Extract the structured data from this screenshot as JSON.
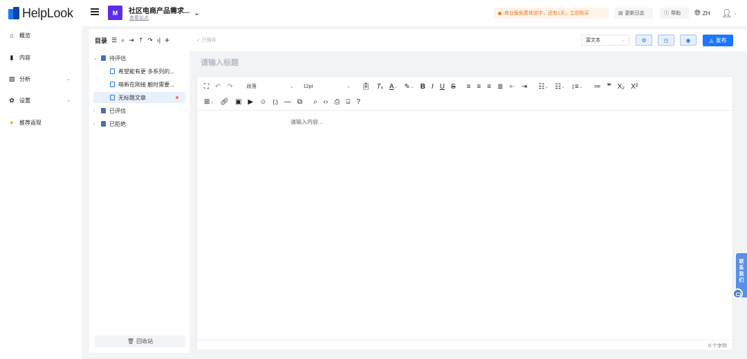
{
  "brand": {
    "name": "HelpLook",
    "colors": {
      "primary": "#1a78ff",
      "dark": "#0d47a1"
    }
  },
  "header": {
    "project_icon_text": "M",
    "project_name": "社区电商产品需求...",
    "project_view_link": "查看站点",
    "trial_banner": "商业版免费体验中，还有1天，立即购买",
    "changelog": "更新日志",
    "help": "帮助",
    "lang": "ZH"
  },
  "sidebar": {
    "items": [
      {
        "label": "概览",
        "icon": "home-icon"
      },
      {
        "label": "内容",
        "icon": "book-icon"
      },
      {
        "label": "分析",
        "icon": "chart-icon",
        "has_children": true
      },
      {
        "label": "设置",
        "icon": "gear-icon",
        "has_children": true
      },
      {
        "label": "推荐返现",
        "icon": "coin-icon"
      }
    ]
  },
  "tree": {
    "title": "目录",
    "groups": [
      {
        "label": "待评估",
        "expanded": true,
        "children": [
          {
            "label": "希望能有更 多系列的..."
          },
          {
            "label": "萌新在刚接 触时需要..."
          },
          {
            "label": "无标题文章",
            "active": true
          }
        ]
      },
      {
        "label": "已评估",
        "expanded": false
      },
      {
        "label": "已拒绝",
        "expanded": false
      }
    ],
    "recycle": "回收站"
  },
  "editor": {
    "saved_status": "已保存",
    "mode": "富文本",
    "publish": "发布",
    "title_placeholder": "请输入标题",
    "block_format": "段落",
    "font_size": "12pt",
    "content_placeholder": "请输入内容...",
    "char_count": "0 个字符"
  },
  "contact": {
    "label_chars": [
      "联",
      "系",
      "我",
      "们"
    ]
  }
}
